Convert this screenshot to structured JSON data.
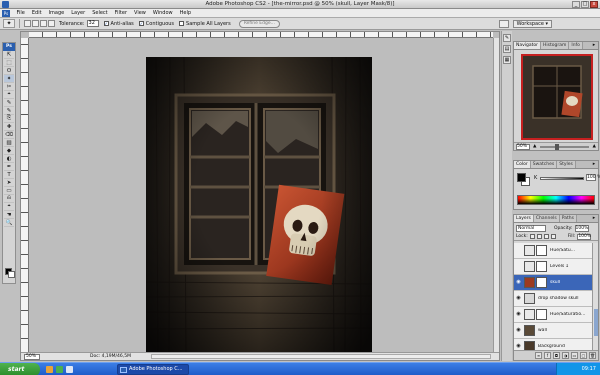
{
  "window": {
    "title": "Adobe Photoshop CS2 - [the-mirror.psd @ 50% (skull, Layer Mask/8)]",
    "controls": [
      "_",
      "□",
      "x"
    ]
  },
  "menubar": {
    "logo": "Ps",
    "items": [
      "File",
      "Edit",
      "Image",
      "Layer",
      "Select",
      "Filter",
      "View",
      "Window",
      "Help"
    ]
  },
  "options": {
    "tolerance_label": "Tolerance:",
    "tolerance_value": "32",
    "antialias_label": "Anti-alias",
    "contiguous_label": "Contiguous",
    "sample_label": "Sample All Layers",
    "refine_label": "Refine Edge...",
    "workspace_label": "Workspace ▾"
  },
  "toolbox": {
    "header": "Ps",
    "tools": [
      "⇱",
      "⬚",
      "ʘ",
      "✂",
      "⌖",
      "✎",
      "⎘",
      "✚",
      "⌫",
      "▨",
      "◆",
      "✦",
      "✒",
      "T",
      "➤",
      "▭",
      "☚",
      "🔍",
      "⎌",
      "◐"
    ]
  },
  "document": {
    "zoom": "50%",
    "info": "Doc: 4,19M/46,5M"
  },
  "navigator": {
    "tabs": [
      "Navigator",
      "Histogram",
      "Info"
    ],
    "zoom": "50%"
  },
  "color_panel": {
    "tabs": [
      "Color",
      "Swatches",
      "Styles"
    ],
    "channel_label": "K",
    "value": "100",
    "unit": "%"
  },
  "layers_panel": {
    "tabs": [
      "Layers",
      "Channels",
      "Paths"
    ],
    "blend_mode": "Normal",
    "opacity_label": "Opacity:",
    "opacity_value": "100%",
    "lock_label": "Lock:",
    "fill_label": "Fill:",
    "fill_value": "100%",
    "layers": [
      {
        "name": "Hue/Satu...",
        "visible": false,
        "selected": false,
        "thumb_color": "#e8e8e8",
        "has_mask": true
      },
      {
        "name": "Levels 1",
        "visible": false,
        "selected": false,
        "thumb_color": "#e8e8e8",
        "has_mask": true
      },
      {
        "name": "skull",
        "visible": true,
        "selected": true,
        "thumb_color": "#9c3a20",
        "has_mask": true
      },
      {
        "name": "drop shadow skull",
        "visible": true,
        "selected": false,
        "thumb_color": "#d8d8d8",
        "has_mask": false
      },
      {
        "name": "Hue/Saturatio...",
        "visible": true,
        "selected": false,
        "thumb_color": "#eaeaea",
        "has_mask": true
      },
      {
        "name": "wall",
        "visible": true,
        "selected": false,
        "thumb_color": "#5a4a38",
        "has_mask": false
      },
      {
        "name": "Background",
        "visible": true,
        "selected": false,
        "thumb_color": "#4a3a2a",
        "has_mask": false
      }
    ]
  },
  "taskbar": {
    "start_label": "start",
    "task_label": "Adobe Photoshop C...",
    "clock": "09:17"
  },
  "colors": {
    "accent": "#3b66b8",
    "canvas_bg": "#bdbdbd",
    "navigator_frame": "#c62020"
  },
  "icons": {
    "magic_wand": "magic-wand-icon",
    "eye": "eye-icon"
  }
}
